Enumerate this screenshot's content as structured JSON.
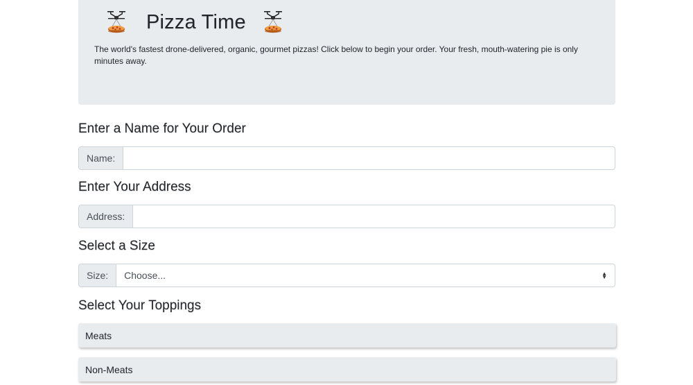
{
  "header": {
    "title": "Pizza Time",
    "tagline": "The world's fastest drone-delivered, organic, gourmet pizzas! Click below to begin your order. Your fresh, mouth-watering pie is only minutes away.",
    "left_icon": "drone-pizza-icon",
    "right_icon": "drone-pizza-icon"
  },
  "name_section": {
    "heading": "Enter a Name for Your Order",
    "label": "Name:",
    "value": "",
    "placeholder": ""
  },
  "address_section": {
    "heading": "Enter Your Address",
    "label": "Address:",
    "value": "",
    "placeholder": ""
  },
  "size_section": {
    "heading": "Select a Size",
    "label": "Size:",
    "selected": "Choose..."
  },
  "toppings_section": {
    "heading": "Select Your Toppings",
    "groups": [
      {
        "label": "Meats"
      },
      {
        "label": "Non-Meats"
      }
    ]
  },
  "colors": {
    "jumbotron_bg": "#e9ecef",
    "addon_bg": "#e9ecef",
    "border": "#ced4da",
    "pizza_orange": "#e07a2a"
  }
}
